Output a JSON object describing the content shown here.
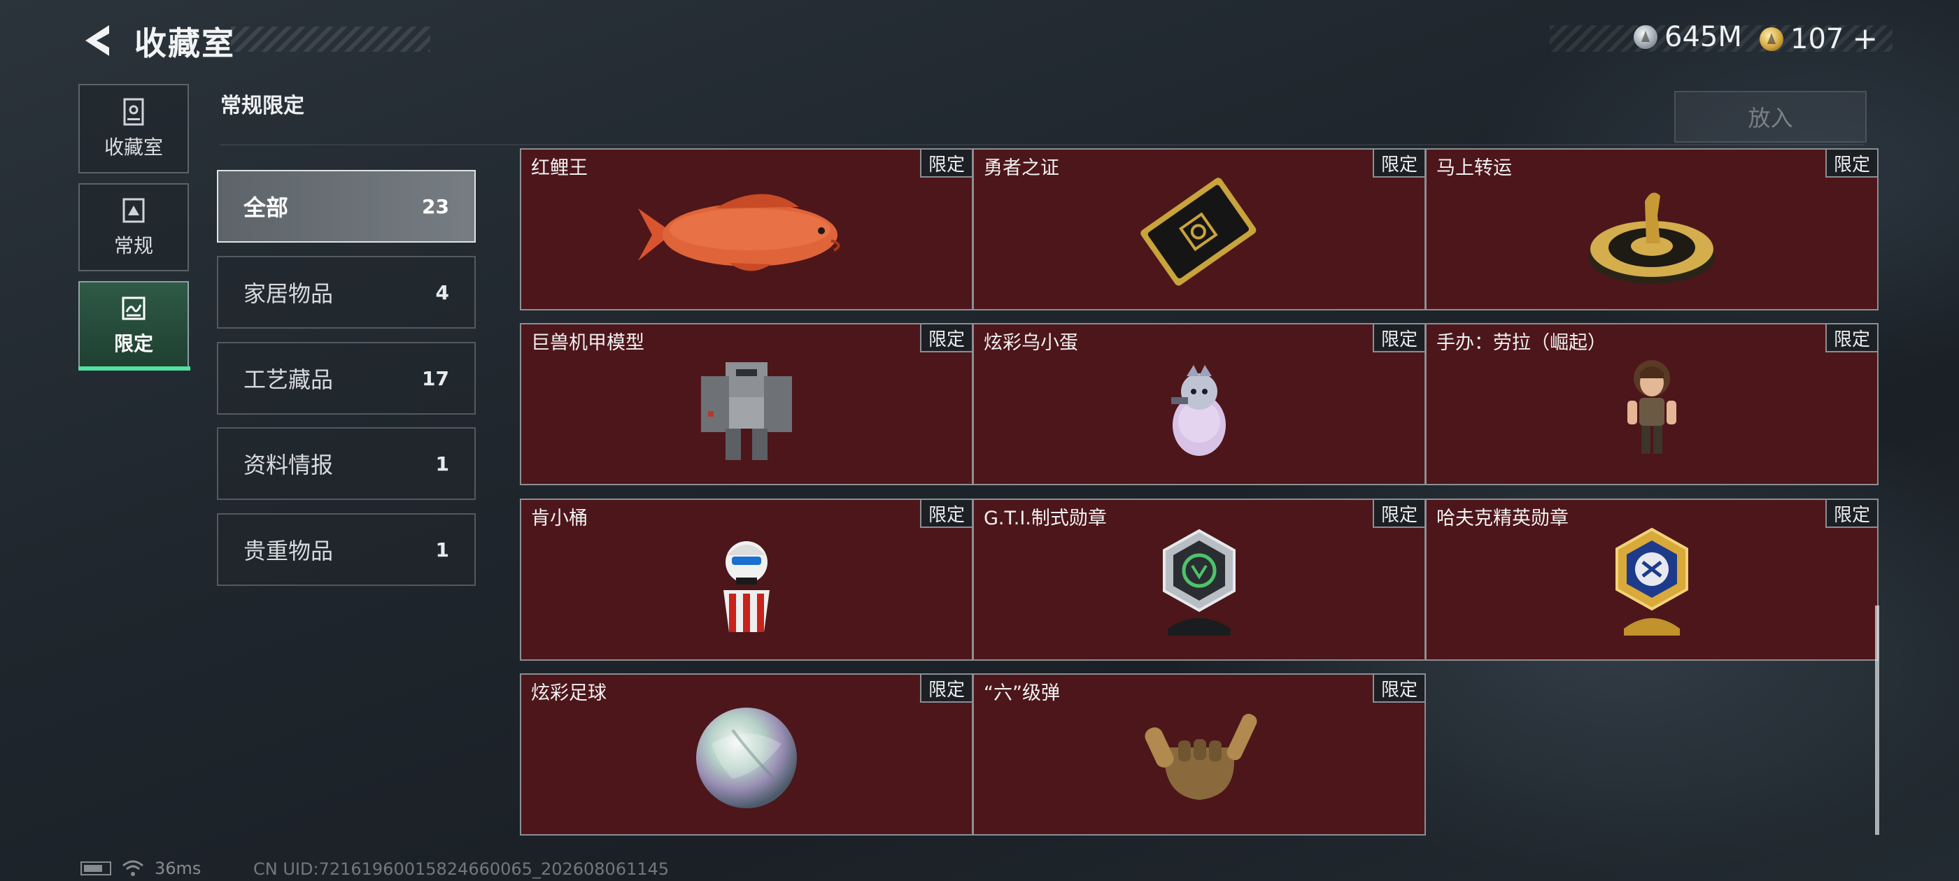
{
  "header": {
    "title": "收藏室",
    "currencies": [
      {
        "icon": "silver-coin-icon",
        "value": "645M"
      },
      {
        "icon": "gold-coin-icon",
        "value": "107",
        "suffix": "+"
      }
    ]
  },
  "nav": {
    "tabs": [
      {
        "label": "收藏室",
        "icon": "collection-room-icon"
      },
      {
        "label": "常规",
        "icon": "regular-icon"
      },
      {
        "label": "限定",
        "icon": "limited-icon",
        "active": true
      }
    ]
  },
  "section": {
    "title": "常规限定",
    "put_button": "放入"
  },
  "categories": [
    {
      "name": "全部",
      "count": "23",
      "active": true
    },
    {
      "name": "家居物品",
      "count": "4"
    },
    {
      "name": "工艺藏品",
      "count": "17"
    },
    {
      "name": "资料情报",
      "count": "1"
    },
    {
      "name": "贵重物品",
      "count": "1"
    }
  ],
  "items": [
    {
      "name": "红鲤王",
      "badge": "限定",
      "icon": "red-carp-icon"
    },
    {
      "name": "勇者之证",
      "badge": "限定",
      "icon": "card-icon"
    },
    {
      "name": "马上转运",
      "badge": "限定",
      "icon": "horse-dial-icon"
    },
    {
      "name": "巨兽机甲模型",
      "badge": "限定",
      "icon": "mech-model-icon"
    },
    {
      "name": "炫彩乌小蛋",
      "badge": "限定",
      "icon": "egg-figure-icon"
    },
    {
      "name": "手办：劳拉（崛起）",
      "badge": "限定",
      "icon": "lara-figure-icon"
    },
    {
      "name": "肯小桶",
      "badge": "限定",
      "icon": "bucket-figure-icon"
    },
    {
      "name": "G.T.I.制式勋章",
      "badge": "限定",
      "icon": "gti-medal-icon"
    },
    {
      "name": "哈夫克精英勋章",
      "badge": "限定",
      "icon": "haavk-medal-icon"
    },
    {
      "name": "炫彩足球",
      "badge": "限定",
      "icon": "iridescent-ball-icon"
    },
    {
      "name": "“六”级弹",
      "badge": "限定",
      "icon": "six-gesture-bullets-icon"
    }
  ],
  "footer": {
    "ping": "36ms",
    "uid": "CN UID:72161960015824660065_202608061145"
  }
}
